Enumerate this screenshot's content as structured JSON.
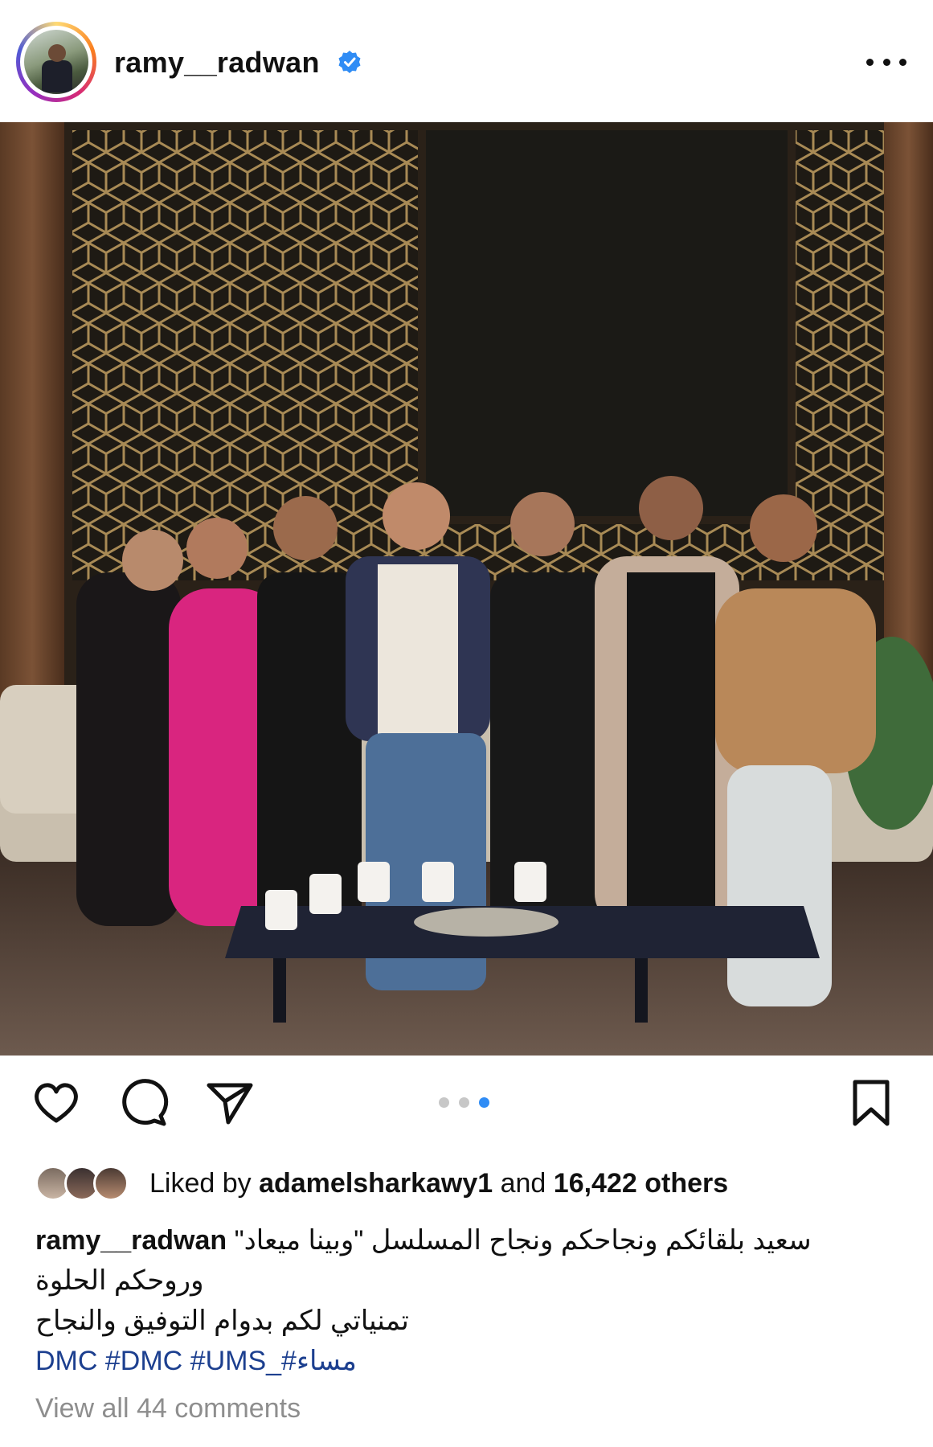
{
  "post": {
    "username": "ramy__radwan",
    "verified": true,
    "more_icon": "more-horizontal-icon"
  },
  "media": {
    "description": "",
    "carousel_total": 3,
    "carousel_active_index": 3
  },
  "actions": {
    "like_icon": "heart-icon",
    "comment_icon": "comment-bubble-icon",
    "share_icon": "paper-plane-icon",
    "save_icon": "bookmark-icon"
  },
  "likes": {
    "prefix": "Liked by ",
    "user": "adamelsharkawy1",
    "middle": " and ",
    "others": "16,422 others"
  },
  "caption": {
    "username": "ramy__radwan",
    "line1": "سعيد بلقائكم ونجاحكم ونجاح المسلسل \"وبينا ميعاد\"",
    "line2": "وروحكم الحلوة",
    "line3": "تمنياتي لكم بدوام التوفيق والنجاح",
    "hashtags": "DMC  #DMC #UMS_#مساء"
  },
  "comments": {
    "view_all": "View all 44 comments"
  }
}
